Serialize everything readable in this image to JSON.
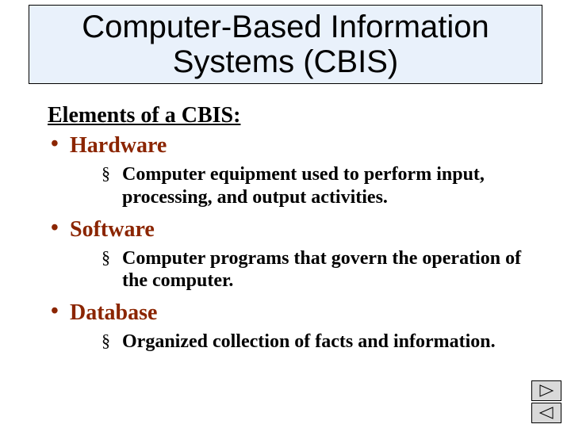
{
  "title": "Computer-Based Information Systems (CBIS)",
  "section_heading": "Elements of a CBIS:",
  "items": [
    {
      "label": "Hardware",
      "desc": "Computer equipment used to perform input, processing, and output activities."
    },
    {
      "label": "Software",
      "desc": "Computer programs that govern the operation of the computer."
    },
    {
      "label": "Database",
      "desc": "Organized collection of facts and information."
    }
  ],
  "nav": {
    "next": "Next",
    "prev": "Previous"
  }
}
